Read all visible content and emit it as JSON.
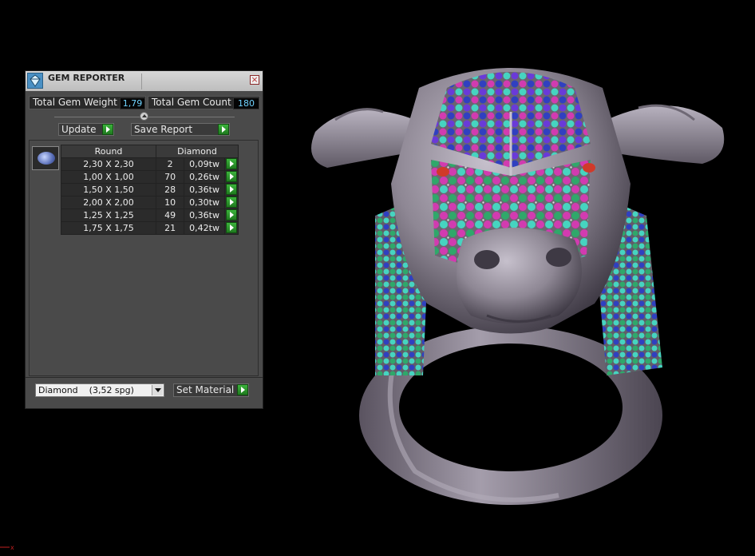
{
  "panel": {
    "title": "GEM REPORTER",
    "close_glyph": "×",
    "total_weight_label": "Total Gem Weight",
    "total_weight_value": "1,79",
    "total_count_label": "Total Gem Count",
    "total_count_value": "180",
    "update_label": "Update",
    "save_report_label": "Save Report",
    "table": {
      "headers": [
        "Round",
        "Diamond"
      ],
      "rows": [
        {
          "size": "2,30 X 2,30",
          "count": "2",
          "weight": "0,09tw"
        },
        {
          "size": "1,00 X 1,00",
          "count": "70",
          "weight": "0,26tw"
        },
        {
          "size": "1,50 X 1,50",
          "count": "28",
          "weight": "0,36tw"
        },
        {
          "size": "2,00 X 2,00",
          "count": "10",
          "weight": "0,30tw"
        },
        {
          "size": "1,25 X 1,25",
          "count": "49",
          "weight": "0,36tw"
        },
        {
          "size": "1,75 X 1,75",
          "count": "21",
          "weight": "0,42tw"
        }
      ]
    },
    "material_value": "Diamond    (3,52 spg)",
    "set_material_label": "Set Material"
  },
  "viewport": {
    "corner_glyph": "x",
    "colors": {
      "metal": "#8e8794",
      "gem_pink": "#d23bb0",
      "gem_green": "#2fa86a",
      "gem_cyan": "#46d4c0",
      "gem_blue": "#3040c0",
      "gem_violet": "#6a3ad8",
      "gem_red": "#d03a2a"
    }
  }
}
